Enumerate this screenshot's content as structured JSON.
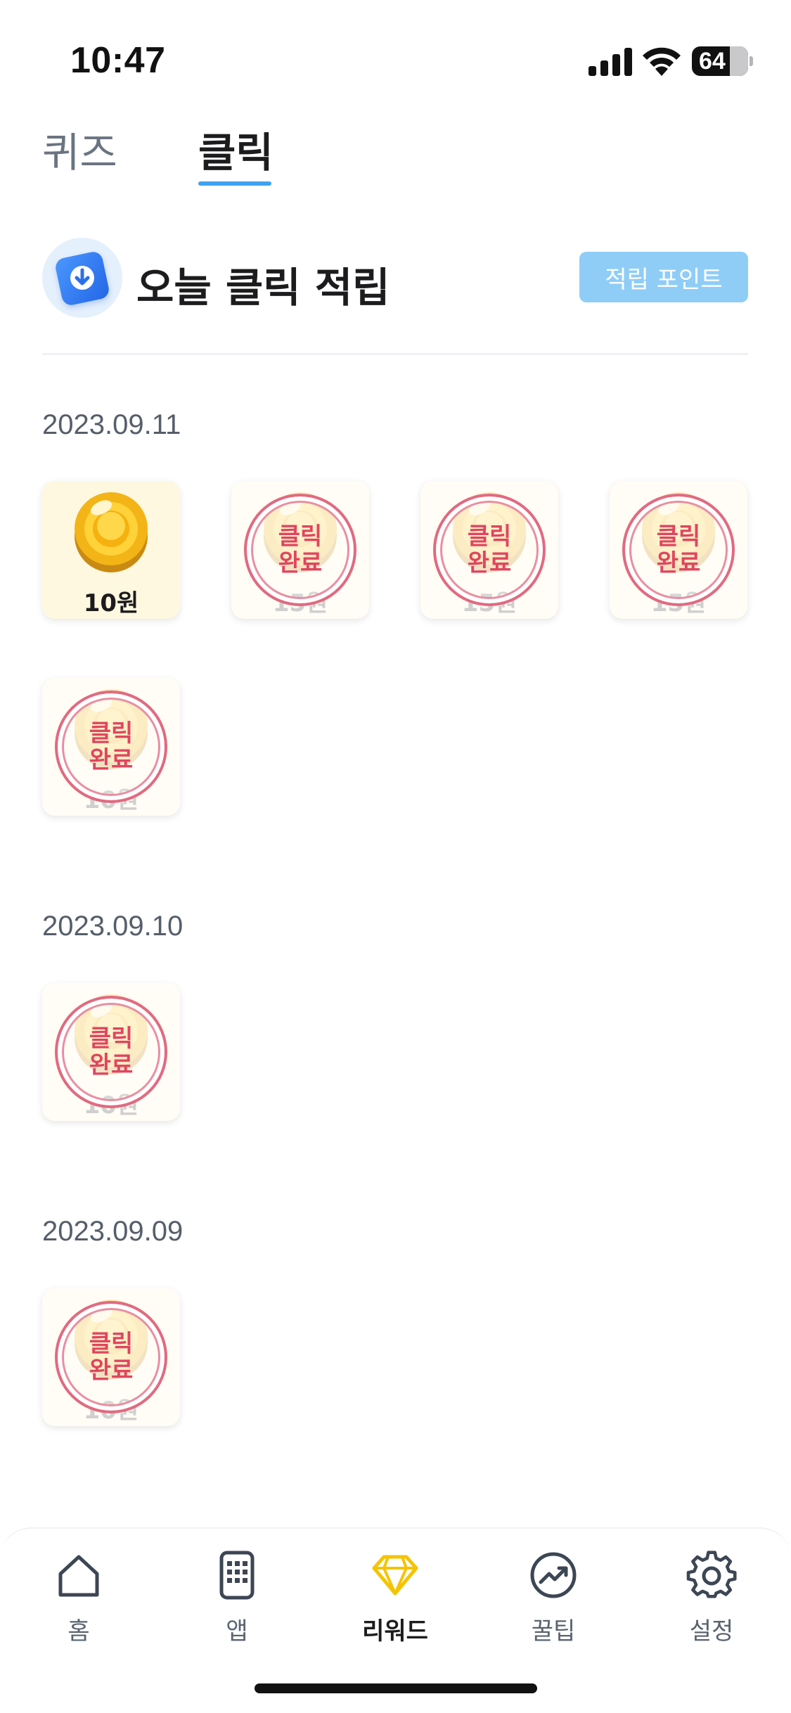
{
  "status": {
    "time": "10:47",
    "battery": "64"
  },
  "tabs": [
    {
      "label": "퀴즈",
      "active": false
    },
    {
      "label": "클릭",
      "active": true
    }
  ],
  "header": {
    "title": "오늘 클릭 적립",
    "points_button": "적립 포인트"
  },
  "groups": [
    {
      "date": "2023.09.11",
      "items": [
        {
          "amount": "10원",
          "done": false
        },
        {
          "amount": "15원",
          "done": true
        },
        {
          "amount": "15원",
          "done": true
        },
        {
          "amount": "15원",
          "done": true
        },
        {
          "amount": "10원",
          "done": true
        }
      ]
    },
    {
      "date": "2023.09.10",
      "items": [
        {
          "amount": "10원",
          "done": true
        }
      ]
    },
    {
      "date": "2023.09.09",
      "items": [
        {
          "amount": "10원",
          "done": true
        }
      ]
    }
  ],
  "stamp": {
    "line1": "클릭",
    "line2": "완료"
  },
  "nav": [
    {
      "label": "홈",
      "icon": "home-icon",
      "active": false
    },
    {
      "label": "앱",
      "icon": "app-grid-icon",
      "active": false
    },
    {
      "label": "리워드",
      "icon": "diamond-icon",
      "active": true
    },
    {
      "label": "꿀팁",
      "icon": "trend-chart-icon",
      "active": false
    },
    {
      "label": "설정",
      "icon": "gear-icon",
      "active": false
    }
  ],
  "colors": {
    "accent": "#3fa2f0",
    "stamp": "#e0455f",
    "reward_icon": "#f5c400"
  }
}
